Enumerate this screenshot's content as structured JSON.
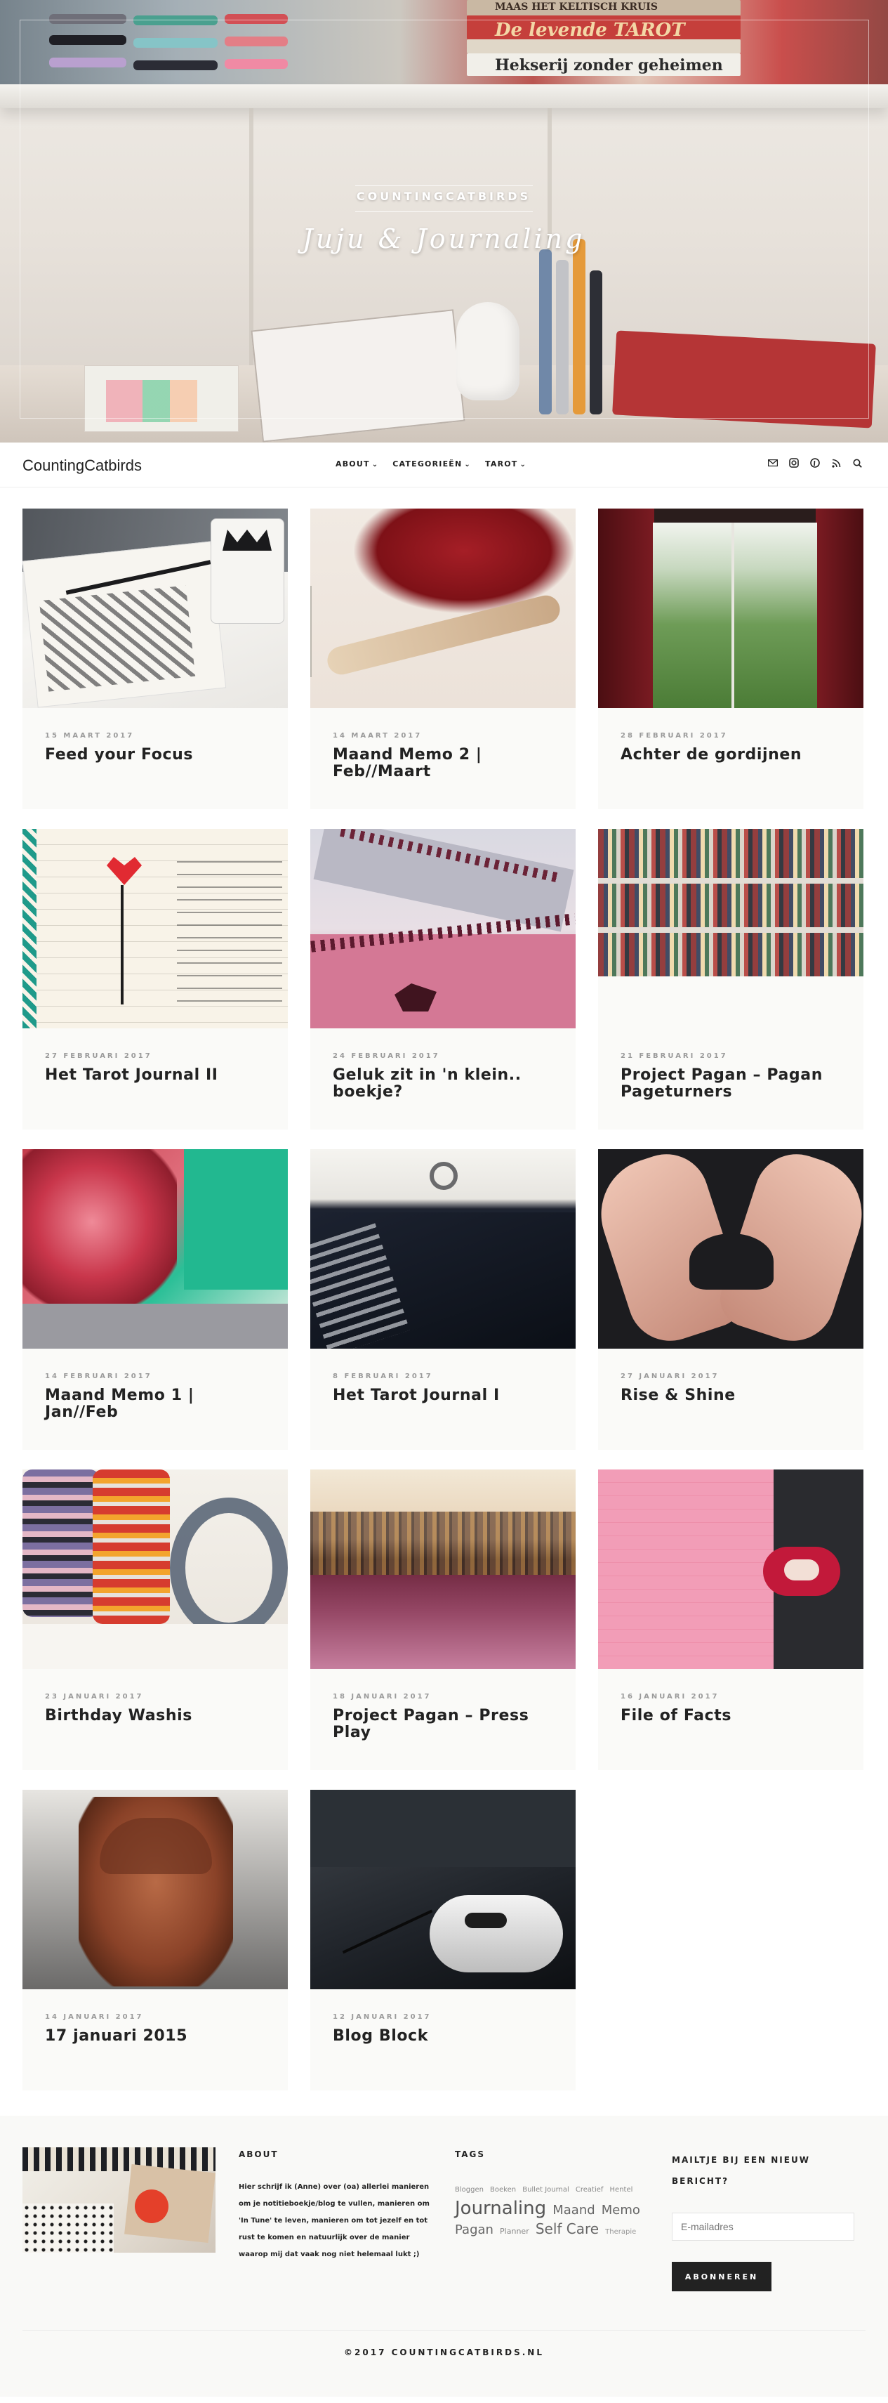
{
  "hero": {
    "brand": "COUNTINGCATBIRDS",
    "tagline": "Juju & Journaling",
    "book_texts": {
      "line1": "MAAS   HET KELTISCH KRUIS",
      "line2": "De levende TAROT",
      "line3": "Hekserij zonder geheimen"
    }
  },
  "nav": {
    "site_title": "CountingCatbirds",
    "menu": [
      {
        "label": "ABOUT"
      },
      {
        "label": "CATEGORIEËN"
      },
      {
        "label": "TAROT"
      }
    ],
    "socials": [
      {
        "icon": "mail-icon"
      },
      {
        "icon": "instagram-icon"
      },
      {
        "icon": "pinterest-icon"
      },
      {
        "icon": "rss-icon"
      },
      {
        "icon": "search-icon"
      }
    ]
  },
  "posts": [
    {
      "date": "15 MAART 2017",
      "title": "Feed your Focus"
    },
    {
      "date": "14 MAART 2017",
      "title": "Maand Memo 2 | Feb//Maart"
    },
    {
      "date": "28 FEBRUARI 2017",
      "title": "Achter de gordijnen"
    },
    {
      "date": "27 FEBRUARI 2017",
      "title": "Het Tarot Journal II"
    },
    {
      "date": "24 FEBRUARI 2017",
      "title": "Geluk zit in 'n klein.. boekje?"
    },
    {
      "date": "21 FEBRUARI 2017",
      "title": "Project Pagan – Pagan Pageturners"
    },
    {
      "date": "14 FEBRUARI 2017",
      "title": "Maand Memo 1 | Jan//Feb"
    },
    {
      "date": "8 FEBRUARI 2017",
      "title": "Het Tarot Journal I"
    },
    {
      "date": "27 JANUARI 2017",
      "title": "Rise & Shine"
    },
    {
      "date": "23 JANUARI 2017",
      "title": "Birthday Washis"
    },
    {
      "date": "18 JANUARI 2017",
      "title": "Project Pagan – Press Play"
    },
    {
      "date": "16 JANUARI 2017",
      "title": "File of Facts"
    },
    {
      "date": "14 JANUARI 2017",
      "title": "17 januari 2015"
    },
    {
      "date": "12 JANUARI 2017",
      "title": "Blog Block"
    }
  ],
  "footer": {
    "about_heading": "ABOUT",
    "about_text": "Hier schrijf ik (Anne) over (oa) allerlei manieren om je notitieboekje/blog te vullen, manieren om 'In Tune' te leven, manieren om tot jezelf en tot rust te komen en natuurlijk over de manier waarop mij dat vaak nog niet helemaal lukt ;)",
    "tags_heading": "TAGS",
    "tags": [
      {
        "label": "Bloggen",
        "size": "s1"
      },
      {
        "label": "Boeken",
        "size": "s1"
      },
      {
        "label": "Bullet Journal",
        "size": "s1"
      },
      {
        "label": "Creatief",
        "size": "s1"
      },
      {
        "label": "Hentel",
        "size": "s1"
      },
      {
        "label": "Journaling",
        "size": "s3"
      },
      {
        "label": "Maand",
        "size": "s4"
      },
      {
        "label": "Memo",
        "size": "s4"
      },
      {
        "label": "Pagan",
        "size": "s4"
      },
      {
        "label": "Planner",
        "size": "s2"
      },
      {
        "label": "Self Care",
        "size": "s5"
      },
      {
        "label": "Therapie",
        "size": "s6"
      }
    ],
    "mail_heading": "MAILTJE BIJ EEN NIEUW BERICHT?",
    "mail_placeholder": "E-mailadres",
    "mail_button": "ABONNEREN",
    "copyright": "©2017 COUNTINGCATBIRDS.NL"
  },
  "colors": {
    "accent_text": "#222222",
    "muted_text": "#9a9a9a",
    "card_bg": "#fafaf8",
    "button_bg": "#222222"
  }
}
